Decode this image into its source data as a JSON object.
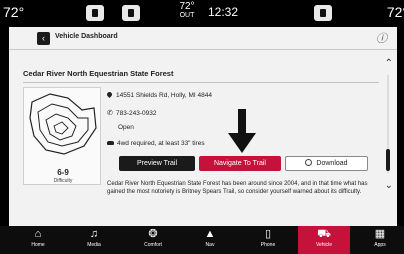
{
  "status_bar": {
    "temp_left": "72°",
    "temp_right": "72°",
    "outside_temp": "72°",
    "outside_label": "OUT",
    "time": "12:32"
  },
  "header": {
    "title": "Vehicle Dashboard",
    "back_icon": "chevron-left-icon",
    "info_icon": "info-icon"
  },
  "trail": {
    "name": "Cedar River North Equestrian State Forest",
    "difficulty_value": "6-9",
    "difficulty_label": "Difficulty",
    "address": "14551 Shields Rd, Holly, MI 4844",
    "phone": "783-243-0932",
    "hours_status": "Open",
    "requirement": "4wd required, at least 33\" tires",
    "description": "Cedar River North Equestrian State Forest has been around since 2004, and in that time what has gained the most notoriety is Britney Spears Trail, so consider yourself warned about its difficulty."
  },
  "actions": {
    "preview_label": "Preview Trail",
    "navigate_label": "Navigate To Trail",
    "download_label": "Download"
  },
  "nav": {
    "items": [
      {
        "label": "Home",
        "icon": "home-icon"
      },
      {
        "label": "Media",
        "icon": "music-note-icon"
      },
      {
        "label": "Comfort",
        "icon": "comfort-icon"
      },
      {
        "label": "Nav",
        "icon": "navigation-arrow-icon"
      },
      {
        "label": "Phone",
        "icon": "phone-icon"
      },
      {
        "label": "Vehicle",
        "icon": "vehicle-icon"
      },
      {
        "label": "Apps",
        "icon": "apps-grid-icon"
      }
    ],
    "active": "Vehicle"
  },
  "colors": {
    "accent": "#c4123a",
    "screen_bg": "#f2f2f2",
    "frame_bg": "#000000"
  }
}
